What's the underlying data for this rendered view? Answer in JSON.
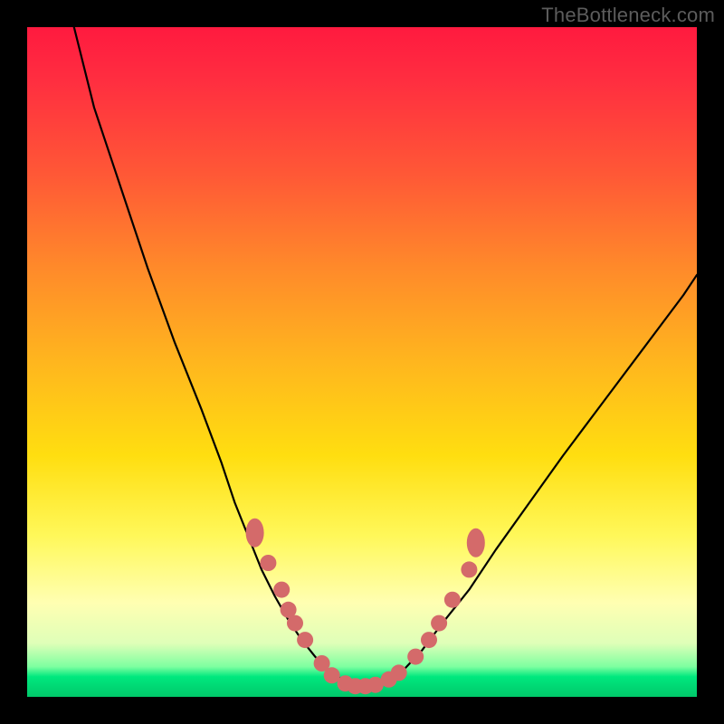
{
  "watermark": "TheBottleneck.com",
  "chart_data": {
    "type": "line",
    "title": "",
    "xlabel": "",
    "ylabel": "",
    "xlim": [
      0,
      100
    ],
    "ylim": [
      0,
      100
    ],
    "x": [
      7,
      10,
      14,
      18,
      22,
      26,
      29,
      31,
      33,
      35,
      37,
      39,
      41,
      43,
      45,
      47,
      49,
      51,
      53,
      56,
      59,
      62,
      66,
      70,
      75,
      80,
      86,
      92,
      98,
      100
    ],
    "values": [
      100,
      88,
      76,
      64,
      53,
      43,
      35,
      29,
      24,
      19,
      15,
      11.5,
      8.5,
      6,
      4,
      2.6,
      1.8,
      1.6,
      2.0,
      3.8,
      7,
      11,
      16,
      22,
      29,
      36,
      44,
      52,
      60,
      63
    ],
    "series": [
      {
        "name": "bottleneck-curve",
        "x": [
          7,
          10,
          14,
          18,
          22,
          26,
          29,
          31,
          33,
          35,
          37,
          39,
          41,
          43,
          45,
          47,
          49,
          51,
          53,
          56,
          59,
          62,
          66,
          70,
          75,
          80,
          86,
          92,
          98,
          100
        ],
        "y": [
          100,
          88,
          76,
          64,
          53,
          43,
          35,
          29,
          24,
          19,
          15,
          11.5,
          8.5,
          6,
          4,
          2.6,
          1.8,
          1.6,
          2.0,
          3.8,
          7,
          11,
          16,
          22,
          29,
          36,
          44,
          52,
          60,
          63
        ]
      }
    ],
    "markers": [
      {
        "x": 34,
        "y": 24.5,
        "shape": "oval"
      },
      {
        "x": 36,
        "y": 20
      },
      {
        "x": 38,
        "y": 16
      },
      {
        "x": 39,
        "y": 13
      },
      {
        "x": 40,
        "y": 11
      },
      {
        "x": 41.5,
        "y": 8.5
      },
      {
        "x": 44,
        "y": 5
      },
      {
        "x": 45.5,
        "y": 3.2
      },
      {
        "x": 47.5,
        "y": 2.0
      },
      {
        "x": 49,
        "y": 1.6
      },
      {
        "x": 50.5,
        "y": 1.6
      },
      {
        "x": 52,
        "y": 1.8
      },
      {
        "x": 54,
        "y": 2.6
      },
      {
        "x": 55.5,
        "y": 3.6
      },
      {
        "x": 58,
        "y": 6
      },
      {
        "x": 60,
        "y": 8.5
      },
      {
        "x": 61.5,
        "y": 11
      },
      {
        "x": 63.5,
        "y": 14.5
      },
      {
        "x": 66,
        "y": 19
      },
      {
        "x": 67,
        "y": 23,
        "shape": "oval"
      }
    ],
    "gradient_stops": [
      {
        "pos": 0.0,
        "color": "#ff1a3f"
      },
      {
        "pos": 0.5,
        "color": "#ffde10"
      },
      {
        "pos": 0.97,
        "color": "#00e87e"
      },
      {
        "pos": 1.0,
        "color": "#00c86a"
      }
    ],
    "marker_color": "#d46a6a"
  }
}
